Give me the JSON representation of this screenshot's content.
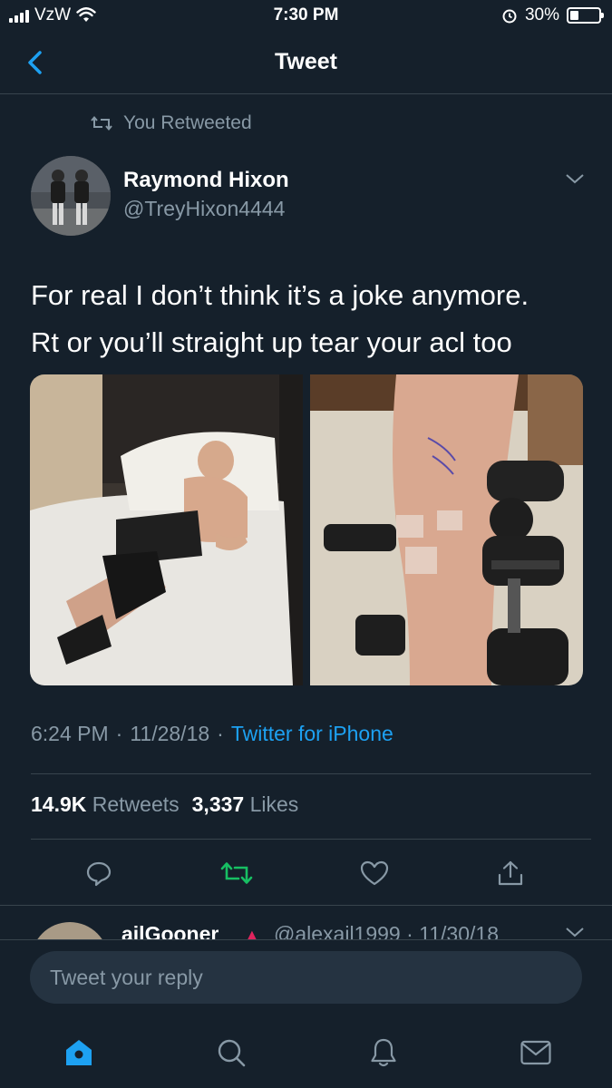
{
  "status_bar": {
    "carrier": "VzW",
    "time": "7:30 PM",
    "battery": "30%",
    "battery_level": 0.3
  },
  "nav": {
    "title": "Tweet",
    "back_icon": "chevron-left-icon"
  },
  "tweet": {
    "retweet_context": "You Retweeted",
    "author_name": "Raymond Hixon",
    "author_handle": "@TreyHixon4444",
    "text_line1": "For real I don’t think it’s a joke anymore.",
    "text_line2": "Rt or you’ll straight up tear your acl too",
    "time": "6:24 PM",
    "date": "11/28/18",
    "source": "Twitter for iPhone",
    "retweet_count": "14.9K",
    "retweet_label": "Retweets",
    "like_count": "3,337",
    "like_label": "Likes"
  },
  "actions": [
    "reply-icon",
    "retweet-icon",
    "like-icon",
    "share-icon"
  ],
  "reply_preview": {
    "name": "ailGooner",
    "handle_date": "@alexail1999 · 11/30/18"
  },
  "compose": {
    "placeholder": "Tweet your reply"
  },
  "tabs": [
    "home-icon",
    "search-icon",
    "notifications-icon",
    "messages-icon"
  ],
  "colors": {
    "background": "#15202b",
    "accent": "#1da1f2",
    "secondary_text": "#8899a6",
    "retweet_green": "#17bf63",
    "divider": "#38444d"
  }
}
